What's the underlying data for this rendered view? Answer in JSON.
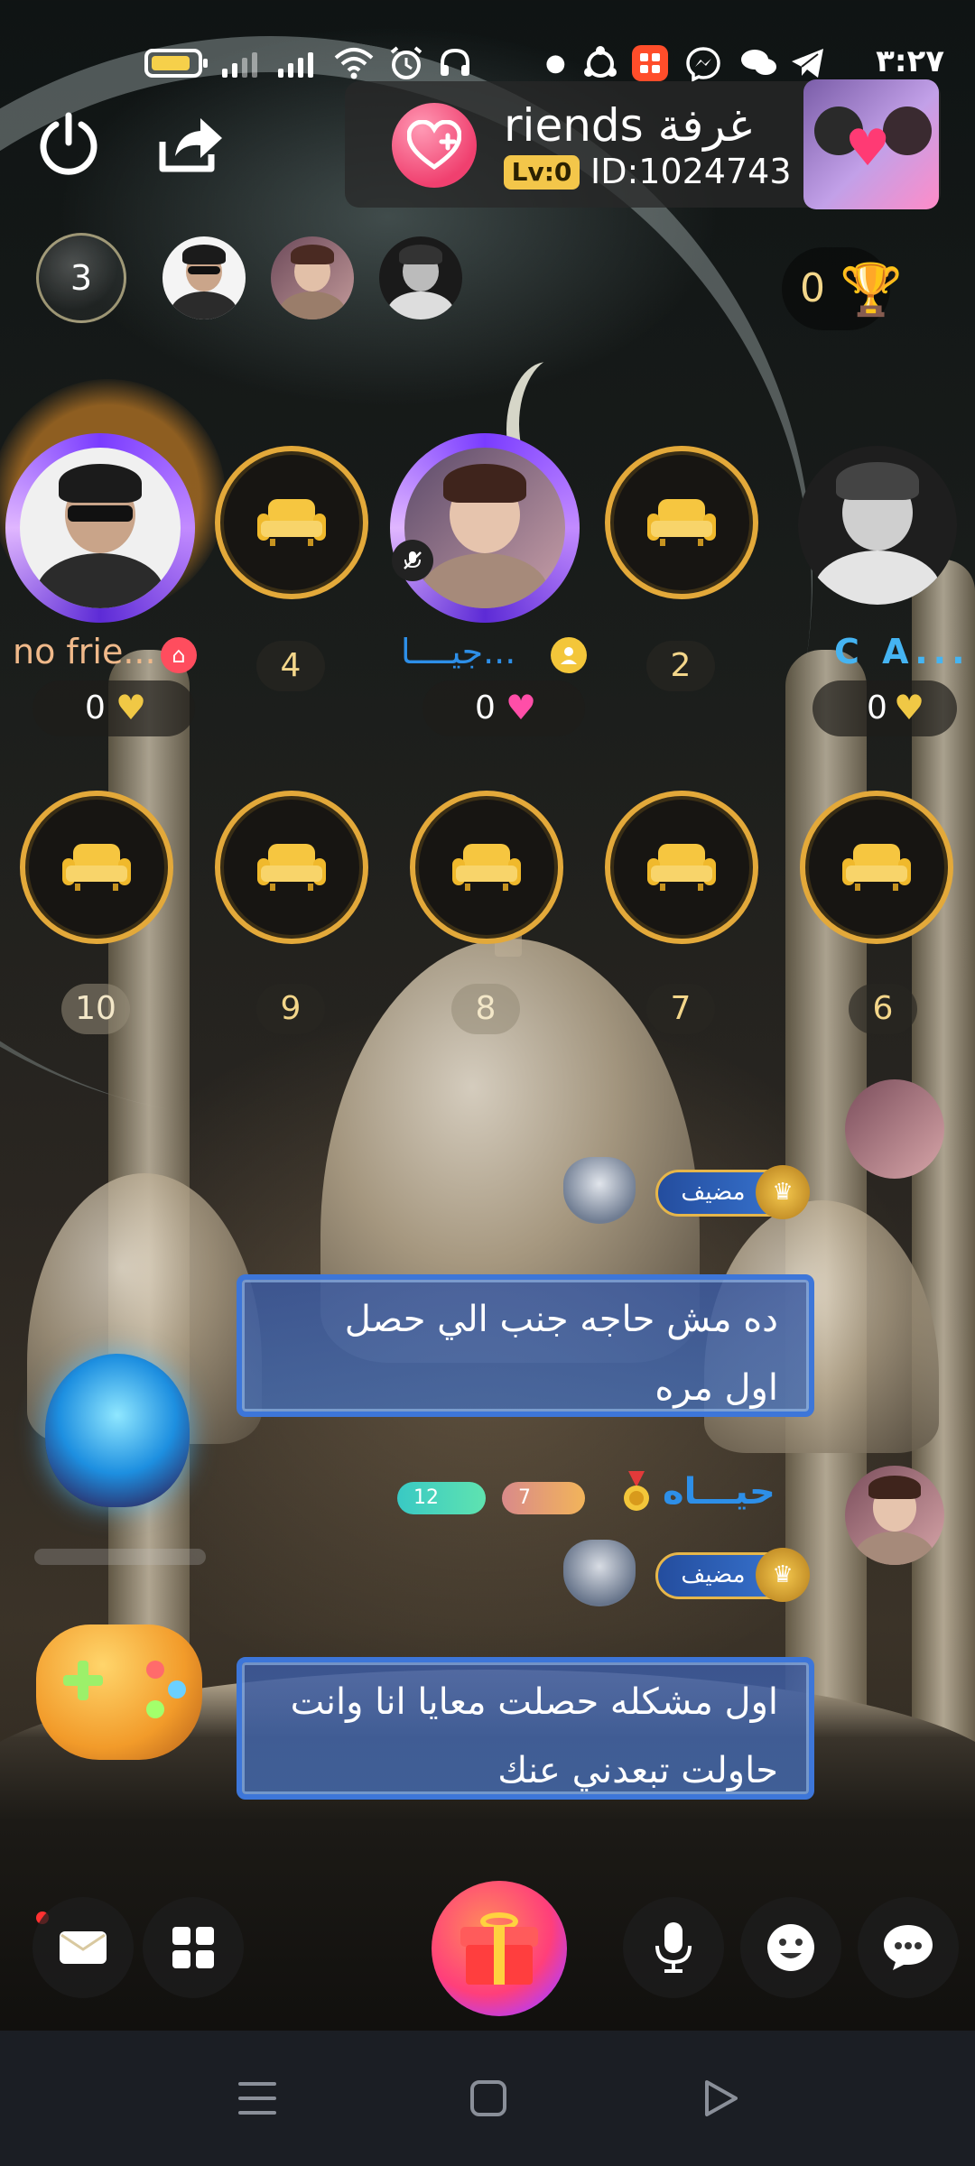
{
  "status_bar": {
    "time": "٣:٢٧",
    "icons": [
      "battery-icon",
      "signal-icon",
      "signal-icon",
      "wifi-icon",
      "alarm-icon",
      "headset-icon",
      "dot-icon",
      "sync-icon",
      "app-icon",
      "messenger-icon",
      "chat-icon",
      "telegram-icon"
    ]
  },
  "room": {
    "name": "riends غرفة",
    "level": "Lv:0",
    "id": "ID:1024743"
  },
  "audience": {
    "online_count": "3",
    "trophy_count": "0"
  },
  "seats_top": [
    {
      "label": "no frie...",
      "score": "0",
      "occupied": true
    },
    {
      "number": "4",
      "occupied": false
    },
    {
      "label": "...جيــــا",
      "score": "0",
      "occupied": true,
      "muted": true
    },
    {
      "number": "2",
      "occupied": false
    },
    {
      "label": "C A...",
      "score": "0",
      "occupied": true
    }
  ],
  "seats_bottom": [
    {
      "number": "10"
    },
    {
      "number": "9"
    },
    {
      "number": "8"
    },
    {
      "number": "7"
    },
    {
      "number": "6"
    }
  ],
  "chat": {
    "guest_label": "مضيف",
    "messages": [
      {
        "username": "حيـــاه",
        "level_a": "12",
        "level_b": "7",
        "line1": "ده مش حاجه جنب الي حصل",
        "line2": "اول مره"
      },
      {
        "username": "حيـــاه",
        "level_a": "12",
        "level_b": "7",
        "line1": "اول مشكله حصلت معايا انا وانت",
        "line2": "حاولت تبعدني عنك"
      }
    ]
  },
  "colors": {
    "accent_gold": "#e3a93a",
    "username_blue": "#2d8fe8",
    "bubble_border": "#3d76d9"
  }
}
